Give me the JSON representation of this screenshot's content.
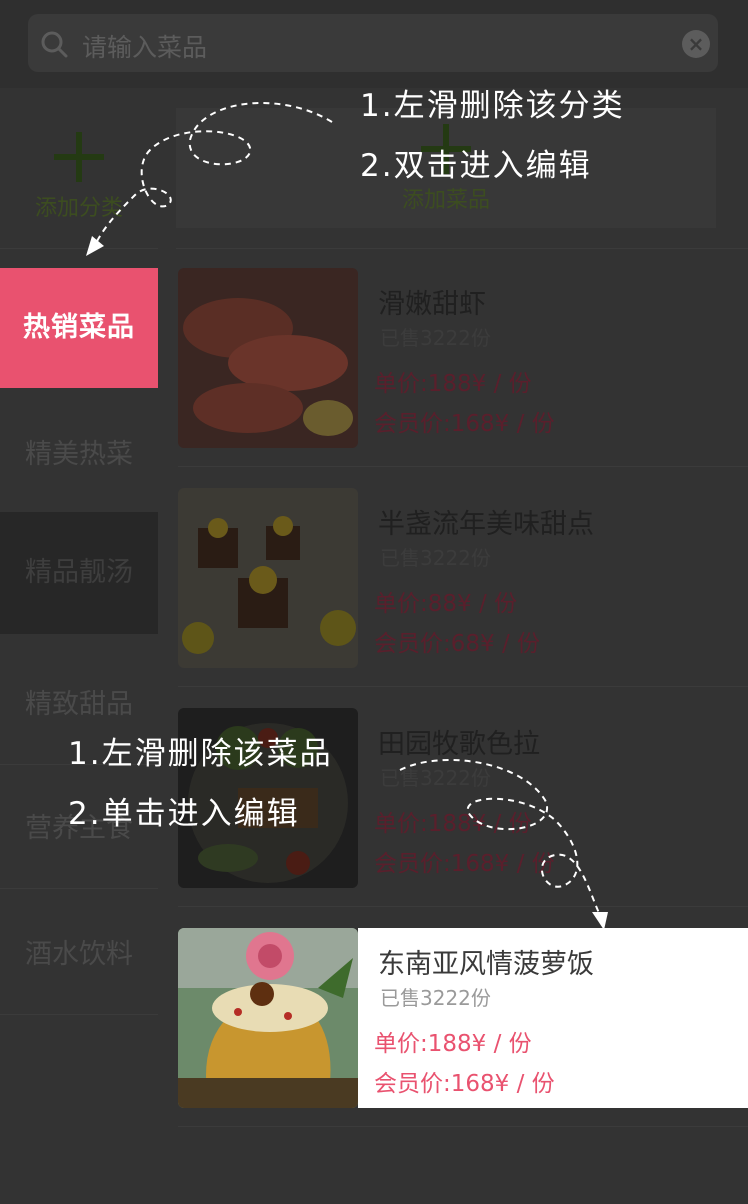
{
  "search": {
    "placeholder": "请输入菜品",
    "clear_icon": "clear-icon"
  },
  "sidebar": {
    "add_label": "添加分类",
    "categories": [
      {
        "label": "热销菜品",
        "state": "active"
      },
      {
        "label": "精美热菜",
        "state": "normal"
      },
      {
        "label": "精品靓汤",
        "state": "pressed"
      },
      {
        "label": "精致甜品",
        "state": "normal"
      },
      {
        "label": "营养主食",
        "state": "normal"
      },
      {
        "label": "酒水饮料",
        "state": "normal"
      }
    ]
  },
  "main": {
    "add_label": "添加菜品",
    "dishes": [
      {
        "name": "滑嫩甜虾",
        "sold": "已售3222份",
        "price": "单价:188¥ / 份",
        "vip_price": "会员价:168¥ / 份"
      },
      {
        "name": "半盏流年美味甜点",
        "sold": "已售3222份",
        "price": "单价:88¥ / 份",
        "vip_price": "会员价:68¥ / 份"
      },
      {
        "name": "田园牧歌色拉",
        "sold": "已售3222份",
        "price": "单价:188¥ / 份",
        "vip_price": "会员价:168¥ / 份"
      },
      {
        "name": "东南亚风情菠萝饭",
        "sold": "已售3222份",
        "price": "单价:188¥ / 份",
        "vip_price": "会员价:168¥ / 份"
      }
    ]
  },
  "tips": {
    "category_line1": "1.左滑删除该分类",
    "category_line2": "2.双击进入编辑",
    "dish_line1": "1.左滑删除该菜品",
    "dish_line2": "2.单击进入编辑"
  },
  "colors": {
    "accent": "#e9526f",
    "overlay": "#303030",
    "add_green": "#243a13"
  }
}
